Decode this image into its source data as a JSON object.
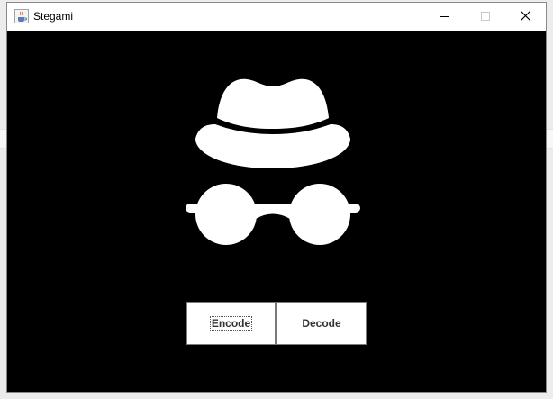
{
  "window": {
    "title": "Stegami",
    "icons": {
      "app": "java-cup-icon",
      "minimize": "minimize-icon",
      "maximize": "maximize-icon",
      "close": "close-icon"
    }
  },
  "main": {
    "logo": "incognito-hat-glasses-icon",
    "buttons": {
      "encode_label": "Encode",
      "decode_label": "Decode"
    }
  },
  "colors": {
    "background": "#000000",
    "logo": "#ffffff",
    "button_bg": "#ffffff",
    "button_text": "#333333"
  }
}
